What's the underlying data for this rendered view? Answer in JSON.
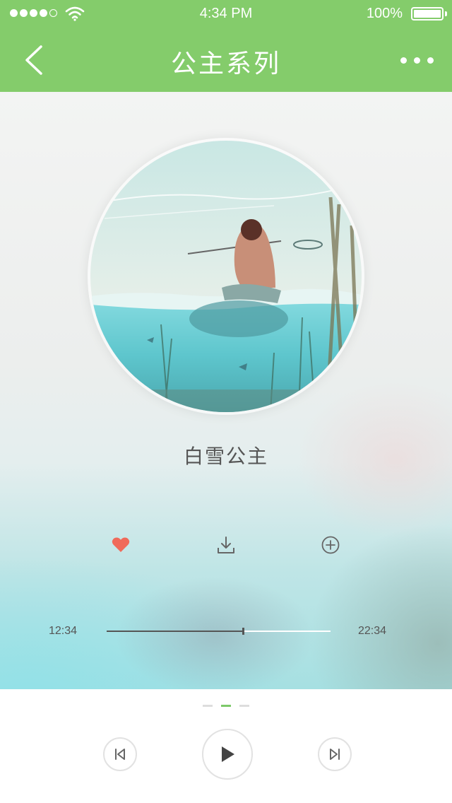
{
  "status_bar": {
    "time": "4:34 PM",
    "battery": "100%",
    "signal_bars": 5,
    "signal_filled": 4
  },
  "nav": {
    "title": "公主系列",
    "back_icon": "chevron-left-icon",
    "more_icon": "more-horizontal-icon"
  },
  "song": {
    "title": "白雪公主",
    "cover_icon": "album-cover-illustration"
  },
  "actions": [
    {
      "name": "favorite",
      "icon": "heart-icon",
      "active": true,
      "color": "#f06a5a"
    },
    {
      "name": "download",
      "icon": "download-icon"
    },
    {
      "name": "add",
      "icon": "plus-circle-icon"
    }
  ],
  "progress": {
    "elapsed": "12:34",
    "total": "22:34",
    "fraction": 0.61
  },
  "pager": {
    "pages": 3,
    "active": 1
  },
  "controls": [
    {
      "name": "previous",
      "icon": "skip-previous-icon"
    },
    {
      "name": "play",
      "icon": "play-icon"
    },
    {
      "name": "next",
      "icon": "skip-next-icon"
    }
  ],
  "colors": {
    "accent": "#84cc6b",
    "heart": "#f06a5a",
    "text": "#555555"
  }
}
